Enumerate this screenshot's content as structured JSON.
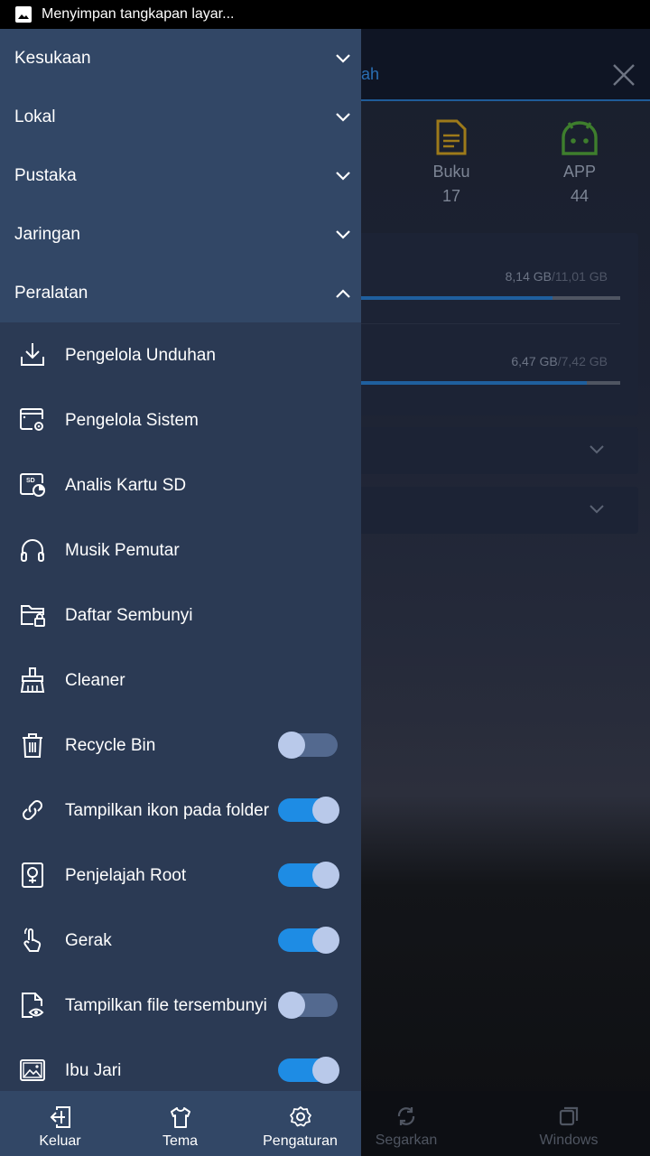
{
  "status_bar": {
    "text": "Menyimpan tangkapan layar..."
  },
  "background_app": {
    "search_partial": "ah",
    "categories": [
      {
        "label": "Buku",
        "count": "17"
      },
      {
        "label": "APP",
        "count": "44"
      }
    ],
    "storage": [
      {
        "used": "8,14 GB",
        "total": "/11,01 GB",
        "fraction": 0.74
      },
      {
        "used": "6,47 GB",
        "total": "/7,42 GB",
        "fraction": 0.87
      }
    ],
    "bottom_nav": [
      {
        "label": "Segarkan",
        "icon": "refresh-icon"
      },
      {
        "label": "Windows",
        "icon": "windows-icon"
      }
    ]
  },
  "drawer": {
    "sections": [
      {
        "label": "Kesukaan",
        "state": "collapsed"
      },
      {
        "label": "Lokal",
        "state": "collapsed"
      },
      {
        "label": "Pustaka",
        "state": "collapsed"
      },
      {
        "label": "Jaringan",
        "state": "collapsed"
      },
      {
        "label": "Peralatan",
        "state": "expanded"
      }
    ],
    "tools": [
      {
        "label": "Pengelola Unduhan",
        "icon": "download-icon"
      },
      {
        "label": "Pengelola Sistem",
        "icon": "system-manager-icon"
      },
      {
        "label": "Analis Kartu SD",
        "icon": "sd-card-analysis-icon"
      },
      {
        "label": "Musik Pemutar",
        "icon": "headphones-icon"
      },
      {
        "label": "Daftar Sembunyi",
        "icon": "hidden-folder-icon"
      },
      {
        "label": "Cleaner",
        "icon": "broom-icon"
      },
      {
        "label": "Recycle Bin",
        "icon": "trash-icon",
        "toggle": false
      },
      {
        "label": "Tampilkan ikon pada folder",
        "icon": "link-icon",
        "toggle": true
      },
      {
        "label": "Penjelajah Root",
        "icon": "root-explorer-icon",
        "toggle": true
      },
      {
        "label": "Gerak",
        "icon": "gesture-icon",
        "toggle": true
      },
      {
        "label": "Tampilkan file tersembunyi",
        "icon": "hidden-file-icon",
        "toggle": false
      },
      {
        "label": "Ibu Jari",
        "icon": "thumbnail-icon",
        "toggle": true
      }
    ],
    "bottom": [
      {
        "label": "Keluar",
        "icon": "exit-icon"
      },
      {
        "label": "Tema",
        "icon": "shirt-icon"
      },
      {
        "label": "Pengaturan",
        "icon": "settings-icon"
      }
    ]
  },
  "colors": {
    "drawer_bg": "#2b3a54",
    "section_bg": "#324766",
    "toggle_on": "#1e8ce4",
    "toggle_off": "#53698f",
    "knob": "#b9c9ea"
  }
}
